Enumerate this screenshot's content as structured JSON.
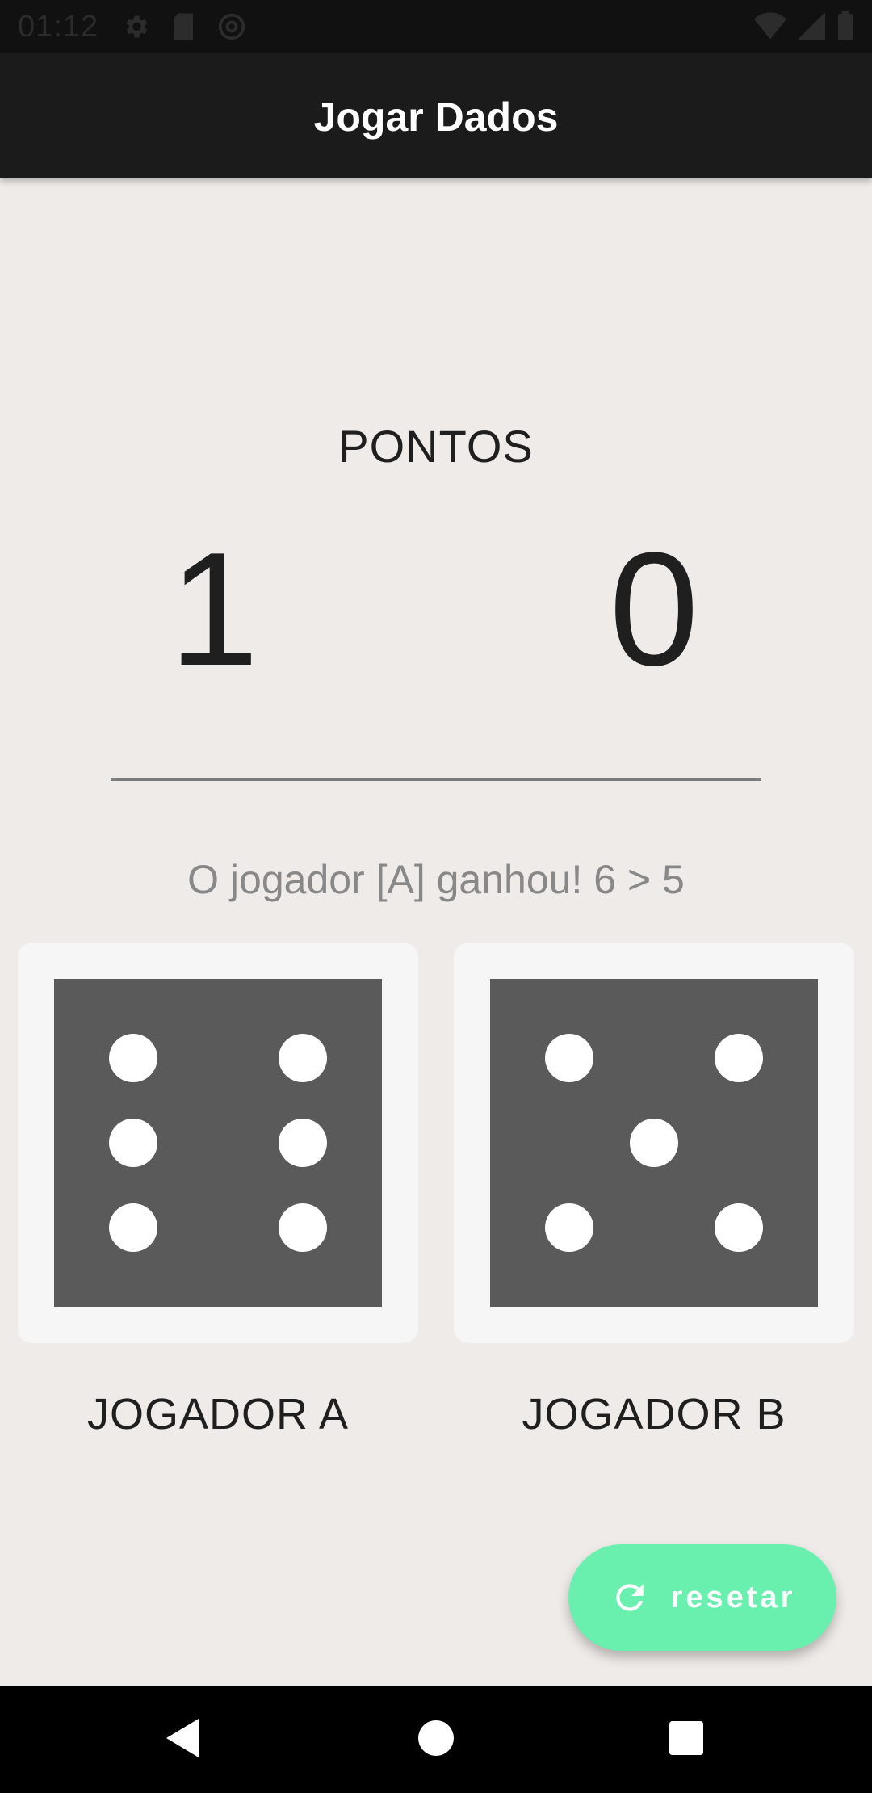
{
  "status_bar": {
    "time": "01:12",
    "left_icons": [
      "gear-icon",
      "sd-card-icon",
      "at-sign-icon"
    ],
    "right_icons": [
      "wifi-icon",
      "signal-icon",
      "battery-icon"
    ]
  },
  "app_bar": {
    "title": "Jogar Dados"
  },
  "scoreboard": {
    "label": "PONTOS",
    "score_a": "1",
    "score_b": "0"
  },
  "result": {
    "message": "O jogador [A] ganhou! 6 > 5"
  },
  "players": [
    {
      "label": "JOGADOR A",
      "die_value": 6
    },
    {
      "label": "JOGADOR B",
      "die_value": 5
    }
  ],
  "fab": {
    "icon": "refresh-icon",
    "label": "resetar"
  },
  "nav_bar": {
    "buttons": [
      "back-icon",
      "home-icon",
      "recents-icon"
    ]
  },
  "colors": {
    "background": "#EEEBE8",
    "app_bar": "#1B1B1B",
    "die_face": "#5A5A5A",
    "die_card": "#F6F6F6",
    "fab": "#6AF0AE"
  }
}
